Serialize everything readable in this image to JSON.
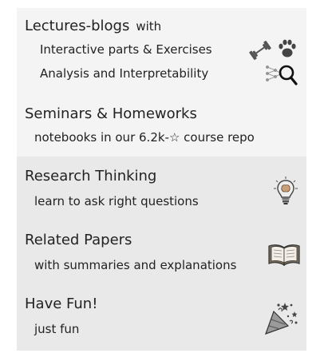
{
  "sections": [
    {
      "title": "Lectures-blogs",
      "title_suffix": "with",
      "lines": [
        "Interactive parts & Exercises",
        "Analysis and Interpretability"
      ],
      "icons": [
        "dumbbell-icon",
        "paw-icon",
        "magnifier-network-icon"
      ]
    },
    {
      "title": "Seminars & Homeworks",
      "lines": [
        "notebooks in our 6.2k-☆ course repo"
      ]
    },
    {
      "title": "Research Thinking",
      "lines": [
        "learn to ask right questions"
      ],
      "icons": [
        "lightbulb-brain-icon"
      ]
    },
    {
      "title": "Related Papers",
      "lines": [
        "with summaries and explanations"
      ],
      "icons": [
        "open-book-icon"
      ]
    },
    {
      "title": "Have Fun!",
      "lines": [
        "just fun"
      ],
      "icons": [
        "party-popper-icon"
      ]
    }
  ]
}
